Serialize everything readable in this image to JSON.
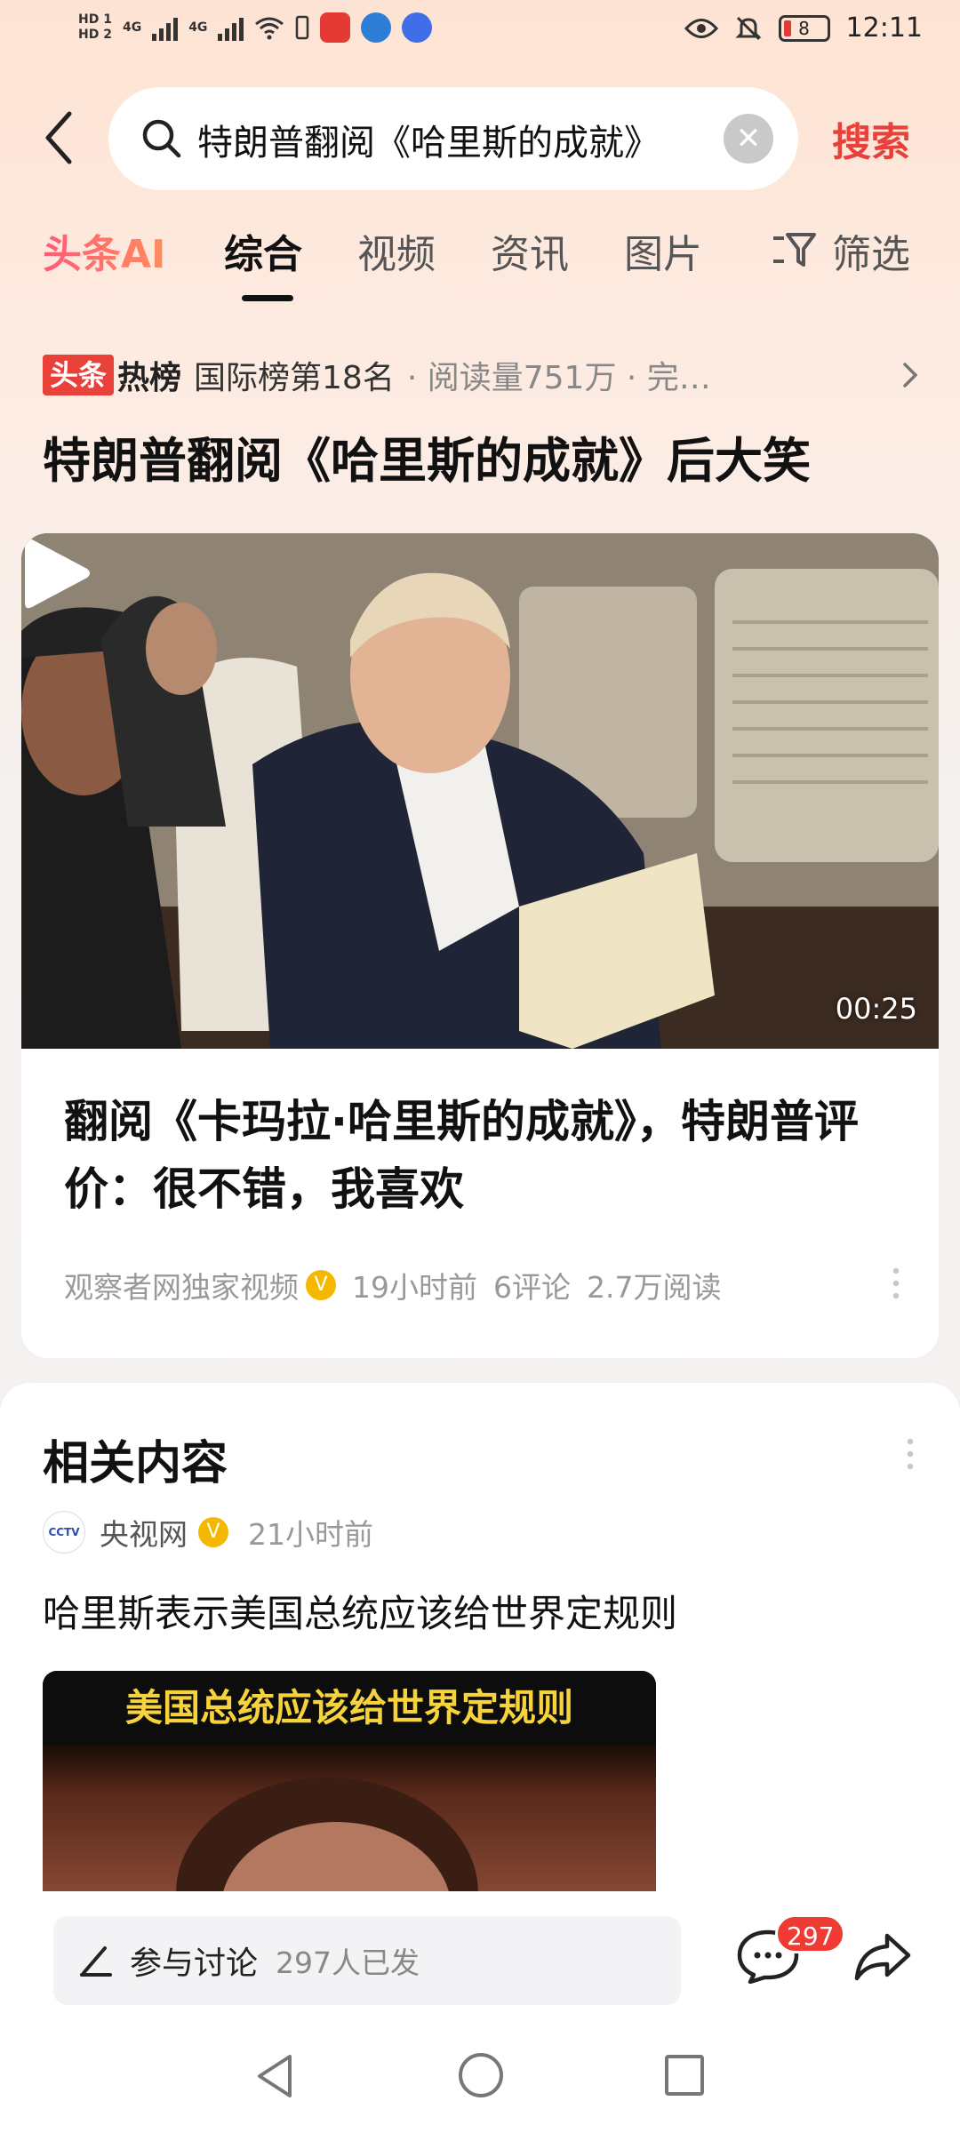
{
  "status_bar": {
    "hd1": "HD 1",
    "hd2": "HD 2",
    "network1": "4G",
    "network2": "4G",
    "battery": "8",
    "time": "12:11"
  },
  "search": {
    "query": "特朗普翻阅《哈里斯的成就》",
    "submit_label": "搜索"
  },
  "tabs": [
    {
      "label": "头条AI"
    },
    {
      "label": "综合",
      "active": true
    },
    {
      "label": "视频"
    },
    {
      "label": "资讯"
    },
    {
      "label": "图片"
    },
    {
      "label": "筛选",
      "icon": "filter-icon"
    }
  ],
  "hot": {
    "logo_a": "头条",
    "logo_b": "热榜",
    "rank": "国际榜第18名",
    "meta": "· 阅读量751万 · 完…",
    "headline": "特朗普翻阅《哈里斯的成就》后大笑"
  },
  "card": {
    "duration": "00:25",
    "title": "翻阅《卡玛拉·哈里斯的成就》，特朗普评价：很不错，我喜欢",
    "source": "观察者网独家视频",
    "time": "19小时前",
    "comments": "6评论",
    "reads": "2.7万阅读"
  },
  "related": {
    "title": "相关内容",
    "source": "央视网",
    "avatar": "CCTV",
    "time": "21小时前",
    "headline": "哈里斯表示美国总统应该给世界定规则",
    "thumb_caption": "美国总统应该给世界定规则"
  },
  "action_bar": {
    "discuss_label": "参与讨论",
    "discuss_count": "297人已发",
    "comment_badge": "297"
  },
  "colors": {
    "accent": "#e8413a",
    "badge": "#f03a34",
    "verified": "#f5b800"
  }
}
